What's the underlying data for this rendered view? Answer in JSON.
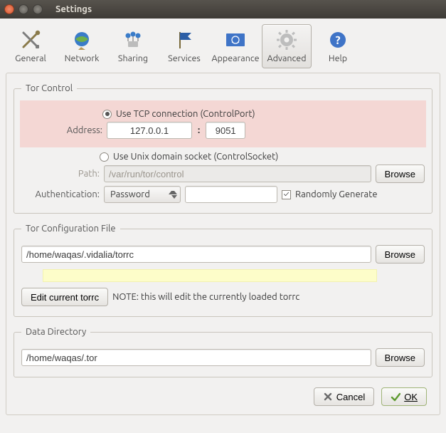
{
  "window": {
    "title": "Settings"
  },
  "toolbar": {
    "general": "General",
    "network": "Network",
    "sharing": "Sharing",
    "services": "Services",
    "appearance": "Appearance",
    "advanced": "Advanced",
    "help": "Help"
  },
  "tor_control": {
    "legend": "Tor Control",
    "tcp_label": "Use TCP connection (ControlPort)",
    "address_label": "Address:",
    "address_value": "127.0.0.1",
    "port_value": "9051",
    "unix_label": "Use Unix domain socket (ControlSocket)",
    "path_label": "Path:",
    "path_value": "/var/run/tor/control",
    "browse": "Browse",
    "auth_label": "Authentication:",
    "auth_mode": "Password",
    "random_label": "Randomly Generate"
  },
  "config_file": {
    "legend": "Tor Configuration File",
    "path": "/home/waqas/.vidalia/torrc",
    "browse": "Browse",
    "edit_btn": "Edit current torrc",
    "note": "NOTE: this will edit the currently loaded torrc"
  },
  "data_dir": {
    "legend": "Data Directory",
    "path": "/home/waqas/.tor",
    "browse": "Browse"
  },
  "footer": {
    "cancel": "Cancel",
    "ok": "OK"
  }
}
